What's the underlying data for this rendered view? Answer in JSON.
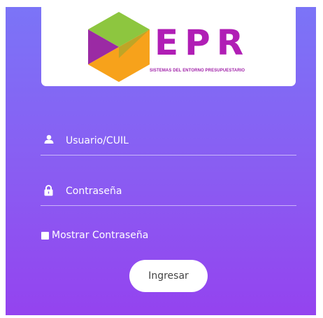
{
  "header": {
    "brand_name": "EPR",
    "brand_subtitle": "SISTEMAS DEL ENTORNO PRESUPUESTARIO"
  },
  "form": {
    "username_label": "Usuario/CUIL",
    "username_icon": "user-icon",
    "password_label": "Contraseña",
    "password_icon": "lock-icon",
    "show_password_label": "Mostrar Contraseña",
    "show_password_checked": false,
    "submit_label": "Ingresar"
  },
  "colors": {
    "gradient_top": "#7b74f7",
    "gradient_bottom": "#9443ef",
    "brand_text": "#b01eb5",
    "logo_green": "#8dc63f",
    "logo_orange": "#f7a21b",
    "logo_purple": "#9b2aa4"
  }
}
